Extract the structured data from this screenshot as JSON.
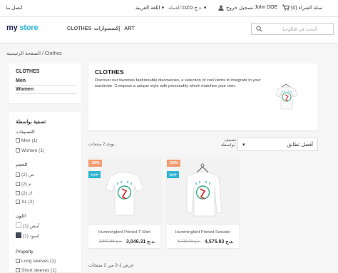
{
  "topbar": {
    "contact": "اتصل بنا",
    "language": "اللغة العربية",
    "language_caret": "▾",
    "currency_label": "العملة:",
    "currency": "DZD د.ج.",
    "currency_caret": "▾",
    "logout": "تسجيل خروج",
    "user": "John DOE",
    "cart": "سلة الشراء (0)",
    "cart_icon": "cart-icon",
    "user_icon": "user-icon"
  },
  "header": {
    "logo_part1": "my ",
    "logo_part2": "store",
    "nav": [
      "CLOTHES",
      "إكسسوارات",
      "ART"
    ],
    "search_placeholder": "البحث في فتالوحنا",
    "search_icon": "search-icon"
  },
  "breadcrumb": {
    "home": "الصفحة الرئيسية",
    "sep": "/",
    "current": "Clothes"
  },
  "categories": {
    "title": "CLOTHES",
    "items": [
      "Men",
      "Women"
    ]
  },
  "filters": {
    "title": "تصفية بواسطة",
    "groups": [
      {
        "name": "التصنيفات",
        "options": [
          "Men (1)",
          "Women (1)"
        ]
      },
      {
        "name": "الحجم",
        "options": [
          "ص (2)",
          "م (2)",
          "ك (2)",
          "XL (2)"
        ]
      },
      {
        "name": "اللون",
        "options": [
          "أبيض (1)",
          "اسود (1)"
        ]
      },
      {
        "name": "Property",
        "options": [
          "Long sleeves (1)",
          "Short sleeves (1)"
        ]
      }
    ]
  },
  "banner": {
    "title": "CLOTHES",
    "text": "Discover our favorites fashionable discoveries, a selection of cool items to integrate in your wardrobe. Compose a unique style with personality which matches your own."
  },
  "listing": {
    "count": "يوجد 2 منتجات.",
    "sort_label": "تصنيف بواسطة:",
    "sort_value": "أفضل تطابق",
    "sort_caret": "▾",
    "showing": "عرض 1-2 من 2 منتجات"
  },
  "products": [
    {
      "discount": "-20%",
      "badge": "جديد",
      "name": "Hummingbird Printed T-Shirt",
      "price": "3,046.31 د.ج.",
      "old_price": "3,807.88 د.ج."
    },
    {
      "discount": "-20%",
      "badge": "جديد",
      "name": "Hummingbird Printed Sweater",
      "price": "4,575.83 د.ج.",
      "old_price": "5,719.79 د.ج."
    }
  ],
  "colors": {
    "accent": "#2fb5d2",
    "discount": "#f39d72",
    "badge": "#2fb5d2",
    "black_swatch": "#434a54"
  }
}
